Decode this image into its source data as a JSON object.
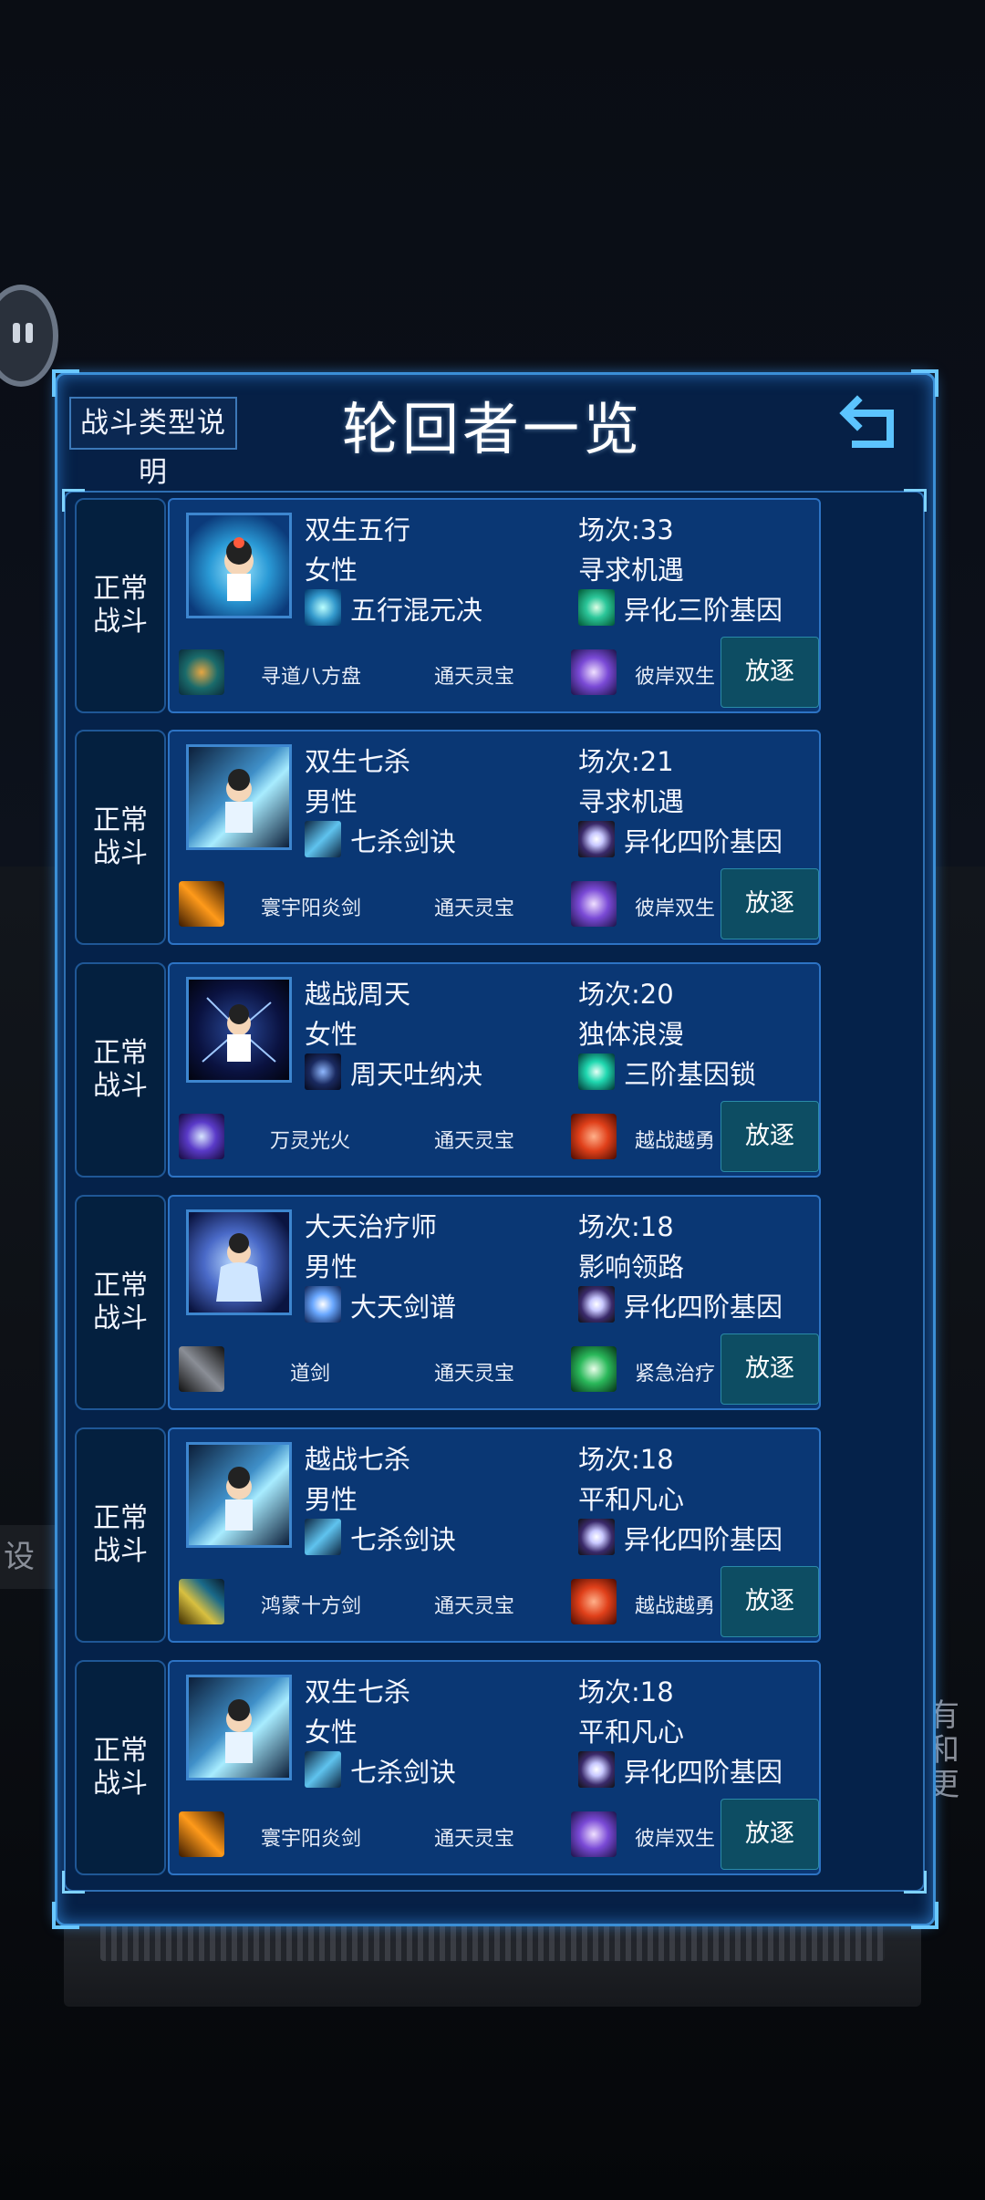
{
  "header": {
    "help_label": "战斗类型说明",
    "title": "轮回者一览"
  },
  "background": {
    "left_char": "设",
    "right_chars": "有\n和\n更"
  },
  "rows": [
    {
      "tag1": "正常",
      "tag2": "战斗",
      "name": "双生五行",
      "gender": "女性",
      "skill": "五行混元决",
      "matches": "场次:33",
      "trait": "寻求机遇",
      "gene": "异化三阶基因",
      "item1": "寻道八方盘",
      "item2": "通天灵宝",
      "item3": "彼岸双生",
      "exile": "放逐"
    },
    {
      "tag1": "正常",
      "tag2": "战斗",
      "name": "双生七杀",
      "gender": "男性",
      "skill": "七杀剑诀",
      "matches": "场次:21",
      "trait": "寻求机遇",
      "gene": "异化四阶基因",
      "item1": "寰宇阳炎剑",
      "item2": "通天灵宝",
      "item3": "彼岸双生",
      "exile": "放逐"
    },
    {
      "tag1": "正常",
      "tag2": "战斗",
      "name": "越战周天",
      "gender": "女性",
      "skill": "周天吐纳决",
      "matches": "场次:20",
      "trait": "独体浪漫",
      "gene": "三阶基因锁",
      "item1": "万灵光火",
      "item2": "通天灵宝",
      "item3": "越战越勇",
      "exile": "放逐"
    },
    {
      "tag1": "正常",
      "tag2": "战斗",
      "name": "大天治疗师",
      "gender": "男性",
      "skill": "大天剑谱",
      "matches": "场次:18",
      "trait": "影响领路",
      "gene": "异化四阶基因",
      "item1": "道剑",
      "item2": "通天灵宝",
      "item3": "紧急治疗",
      "exile": "放逐"
    },
    {
      "tag1": "正常",
      "tag2": "战斗",
      "name": "越战七杀",
      "gender": "男性",
      "skill": "七杀剑诀",
      "matches": "场次:18",
      "trait": "平和凡心",
      "gene": "异化四阶基因",
      "item1": "鸿蒙十方剑",
      "item2": "通天灵宝",
      "item3": "越战越勇",
      "exile": "放逐"
    },
    {
      "tag1": "正常",
      "tag2": "战斗",
      "name": "双生七杀",
      "gender": "女性",
      "skill": "七杀剑诀",
      "matches": "场次:18",
      "trait": "平和凡心",
      "gene": "异化四阶基因",
      "item1": "寰宇阳炎剑",
      "item2": "通天灵宝",
      "item3": "彼岸双生",
      "exile": "放逐"
    }
  ]
}
